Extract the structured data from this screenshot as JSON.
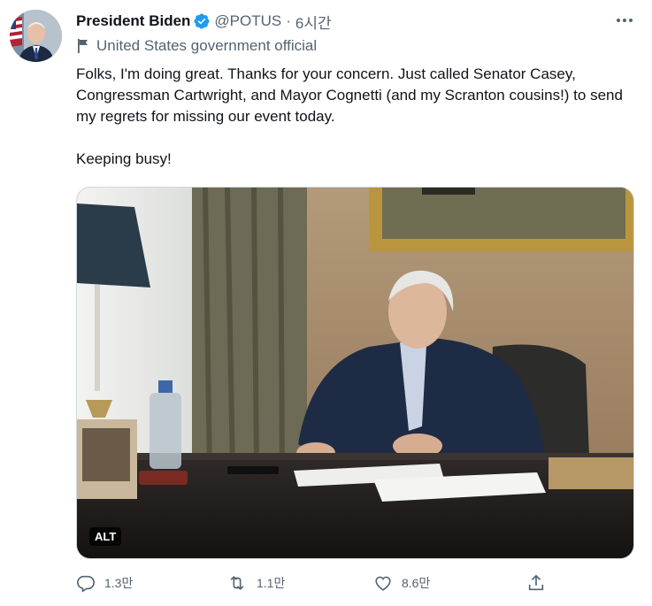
{
  "author": {
    "name": "President Biden",
    "handle": "@POTUS",
    "separator": "·",
    "time": "6시간",
    "label": "United States government official"
  },
  "tweet": {
    "paragraphs": [
      "Folks, I'm doing great. Thanks for your concern. Just called Senator Casey, Congressman Cartwright, and Mayor Cognetti (and my Scranton cousins!) to send my regrets for missing our event today.",
      "Keeping busy!"
    ]
  },
  "media": {
    "alt_badge": "ALT"
  },
  "actions": {
    "reply_count": "1.3만",
    "retweet_count": "1.1만",
    "like_count": "8.6만"
  },
  "icons": {
    "verified": "verified-badge-icon",
    "more": "more-dots-icon",
    "flag": "flag-icon",
    "reply": "reply-icon",
    "retweet": "retweet-icon",
    "like": "heart-icon",
    "share": "share-icon"
  },
  "colors": {
    "verified": "#1d9bf0",
    "secondary_text": "#536471",
    "text": "#0f1419"
  }
}
